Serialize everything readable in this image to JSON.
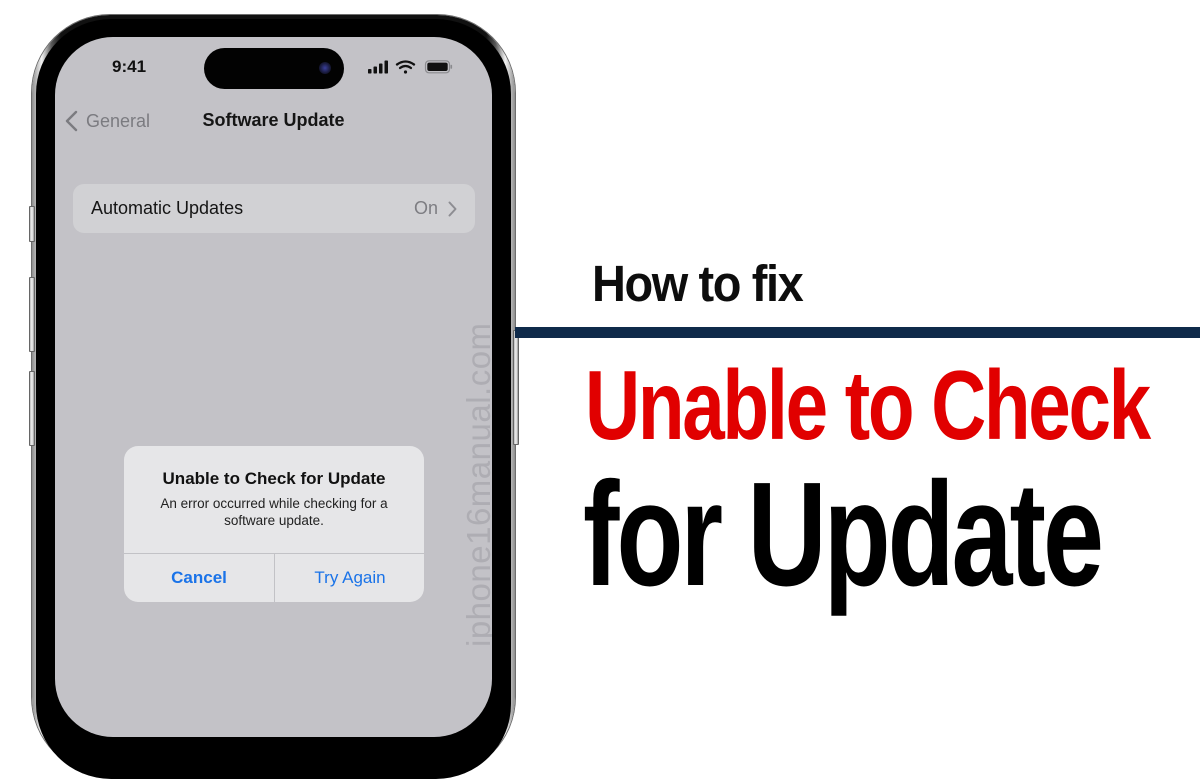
{
  "phone": {
    "status_bar": {
      "time": "9:41",
      "icons": [
        "cellular-signal-icon",
        "wifi-icon",
        "battery-icon"
      ]
    },
    "nav": {
      "back_label": "General",
      "title": "Software Update"
    },
    "settings": [
      {
        "label": "Automatic Updates",
        "value": "On"
      }
    ],
    "alert": {
      "title": "Unable to Check for Update",
      "message": "An error occurred while checking for a software update.",
      "buttons": {
        "cancel": "Cancel",
        "retry": "Try Again"
      }
    },
    "watermark": "iphone16manual.com"
  },
  "headline": {
    "intro": "How to fix",
    "line1": "Unable to Check",
    "line2": "for Update"
  },
  "colors": {
    "accent_red": "#e10000",
    "divider_navy": "#0f2a4a",
    "ios_blue": "#1a73e8",
    "screen_bg": "#c3c2c7"
  }
}
